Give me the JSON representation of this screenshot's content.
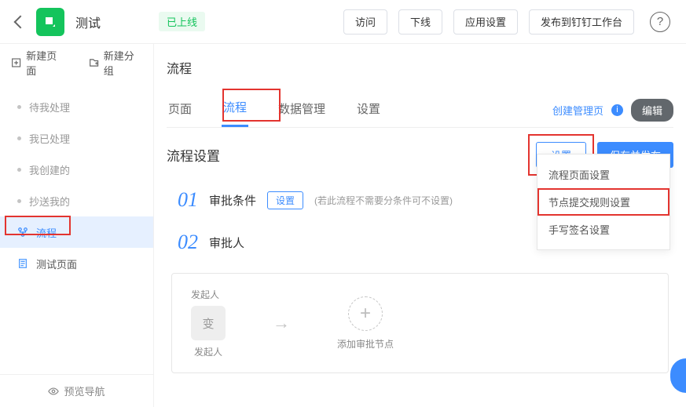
{
  "header": {
    "title": "测试",
    "status": "已上线",
    "buttons": {
      "visit": "访问",
      "offline": "下线",
      "appSettings": "应用设置",
      "publish": "发布到钉钉工作台"
    }
  },
  "sidebar": {
    "newPage": "新建页面",
    "newGroup": "新建分组",
    "items": {
      "todo": "待我处理",
      "done": "我已处理",
      "created": "我创建的",
      "ccme": "抄送我的",
      "flow": "流程",
      "testPage": "测试页面"
    },
    "preview": "预览导航"
  },
  "main": {
    "sectionTitle": "流程",
    "tabs": {
      "page": "页面",
      "flow": "流程",
      "data": "数据管理",
      "settings": "设置"
    },
    "tabsRight": {
      "createMgmt": "创建管理页",
      "edit": "编辑"
    },
    "subTitle": "流程设置",
    "subButtons": {
      "settings": "设置",
      "save": "保存并发布"
    },
    "dropdown": {
      "item1": "流程页面设置",
      "item2": "节点提交规则设置",
      "item3": "手写签名设置"
    },
    "step1": {
      "num": "01",
      "title": "审批条件",
      "btn": "设置",
      "hint": "(若此流程不需要分条件可不设置)"
    },
    "step2": {
      "num": "02",
      "title": "审批人"
    },
    "flow": {
      "initiatorTop": "发起人",
      "initiatorSq": "变",
      "initiatorBot": "发起人",
      "addLabel": "添加审批节点"
    }
  }
}
